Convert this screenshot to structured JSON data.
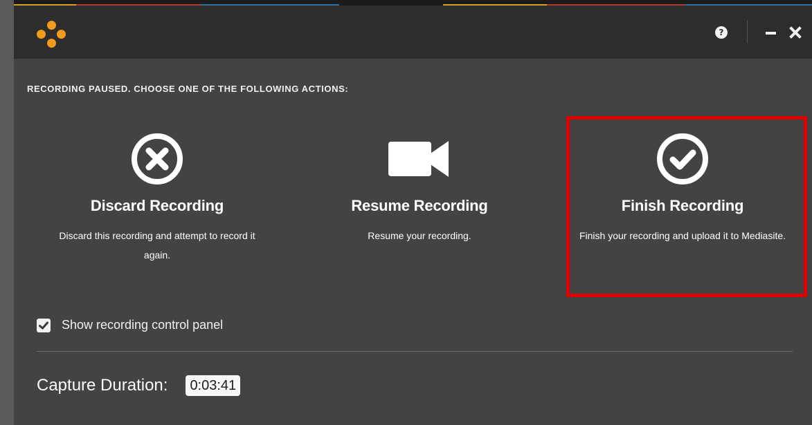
{
  "window": {
    "help_label": "?",
    "instructions": "RECORDING PAUSED. CHOOSE ONE OF THE FOLLOWING ACTIONS:"
  },
  "actions": [
    {
      "icon": "x-circle-icon",
      "title": "Discard Recording",
      "description": "Discard this recording and attempt to record it again."
    },
    {
      "icon": "video-camera-icon",
      "title": "Resume Recording",
      "description": "Resume your recording."
    },
    {
      "icon": "check-circle-icon",
      "title": "Finish Recording",
      "description": "Finish your recording and upload it to Mediasite."
    }
  ],
  "options": {
    "show_control_panel_label": "Show recording control panel",
    "show_control_panel_checked": true
  },
  "capture": {
    "label": "Capture Duration:",
    "duration": "0:03:41"
  },
  "colors": {
    "accent": "#f29b1d",
    "highlight": "#e00000",
    "background": "#434343",
    "titlebar": "#2d2d2d"
  }
}
